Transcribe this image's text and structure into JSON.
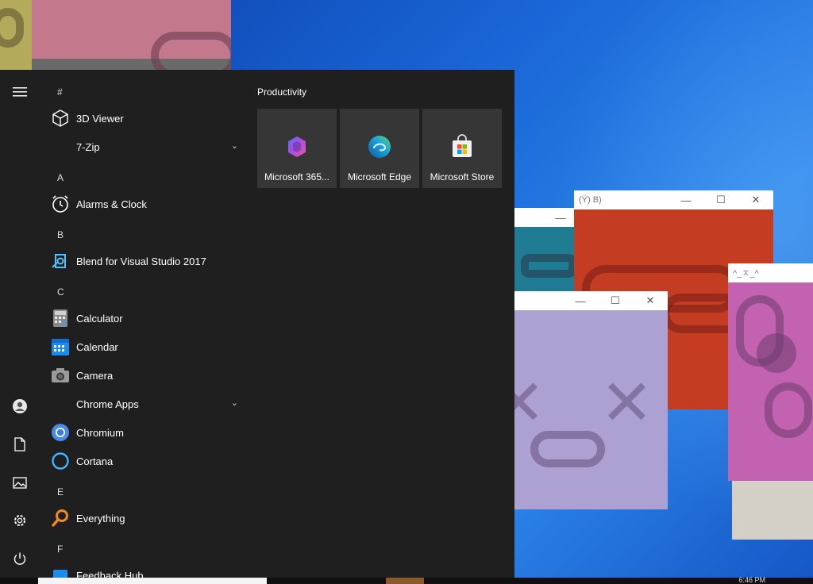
{
  "start_menu": {
    "groups": [
      {
        "letter": "#",
        "apps": [
          {
            "label": "3D Viewer",
            "icon": "cube-icon"
          },
          {
            "label": "7-Zip",
            "icon": "folder-icon",
            "expandable": true
          }
        ]
      },
      {
        "letter": "A",
        "apps": [
          {
            "label": "Alarms & Clock",
            "icon": "alarm-clock-icon"
          }
        ]
      },
      {
        "letter": "B",
        "apps": [
          {
            "label": "Blend for Visual Studio 2017",
            "icon": "blend-icon"
          }
        ]
      },
      {
        "letter": "C",
        "apps": [
          {
            "label": "Calculator",
            "icon": "calculator-icon"
          },
          {
            "label": "Calendar",
            "icon": "calendar-icon"
          },
          {
            "label": "Camera",
            "icon": "camera-icon"
          },
          {
            "label": "Chrome Apps",
            "icon": "folder-icon",
            "expandable": true
          },
          {
            "label": "Chromium",
            "icon": "chromium-icon"
          },
          {
            "label": "Cortana",
            "icon": "cortana-icon"
          }
        ]
      },
      {
        "letter": "E",
        "apps": [
          {
            "label": "Everything",
            "icon": "search-icon"
          }
        ]
      },
      {
        "letter": "F",
        "apps": [
          {
            "label": "Feedback Hub",
            "icon": "feedback-icon"
          }
        ]
      }
    ],
    "tile_group": {
      "title": "Productivity",
      "tiles": [
        {
          "label": "Microsoft 365...",
          "icon": "microsoft-365-icon"
        },
        {
          "label": "Microsoft Edge",
          "icon": "edge-icon"
        },
        {
          "label": "Microsoft Store",
          "icon": "store-icon"
        }
      ]
    },
    "rail": [
      "hamburger-icon",
      "user-icon",
      "documents-icon",
      "pictures-icon",
      "settings-icon",
      "power-icon"
    ]
  },
  "windows": {
    "orange_title": "(Ϋ) B)",
    "pink_title": "^_ㅈ_^"
  },
  "taskbar": {
    "clock_text": "6:46 PM"
  },
  "colors": {
    "start_bg": "#1f1f1f",
    "tile_bg": "#363636",
    "desktop": "#1a66d8"
  }
}
